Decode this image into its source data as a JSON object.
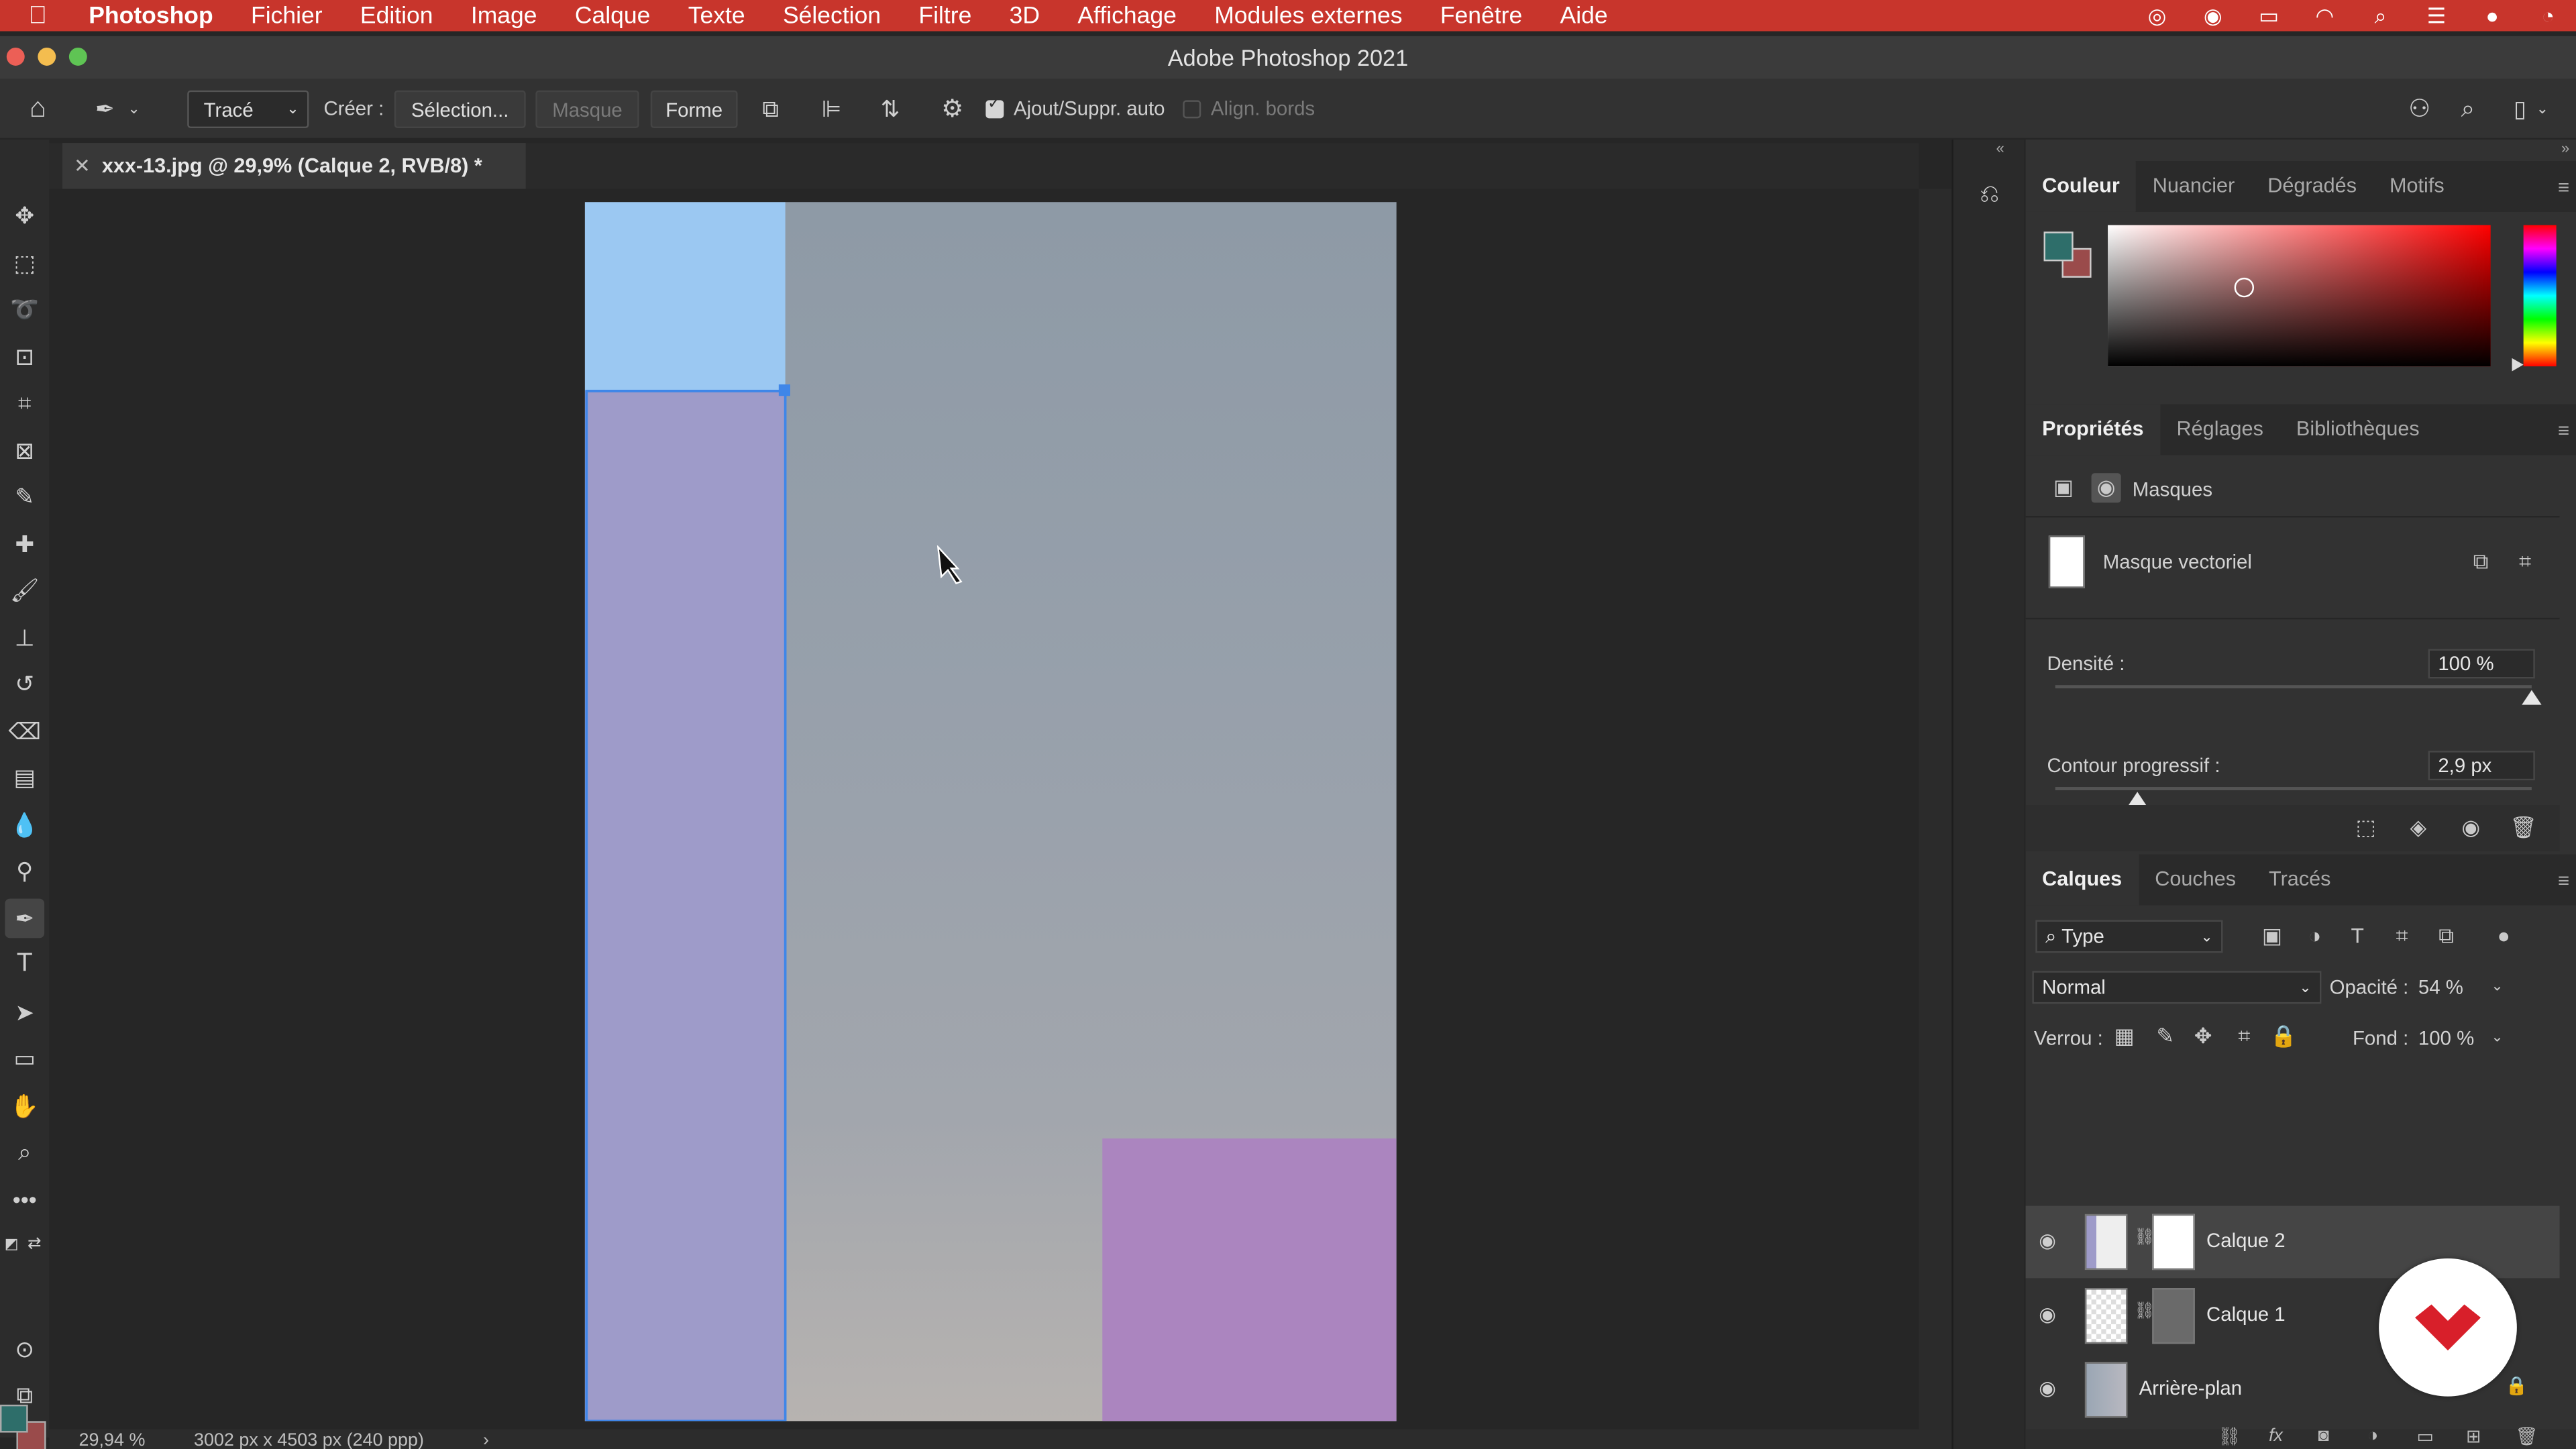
{
  "menubar": {
    "app": "Photoshop",
    "items": [
      "Fichier",
      "Edition",
      "Image",
      "Calque",
      "Texte",
      "Sélection",
      "Filtre",
      "3D",
      "Affichage",
      "Modules externes",
      "Fenêtre",
      "Aide"
    ]
  },
  "window": {
    "title": "Adobe Photoshop 2021"
  },
  "options": {
    "mode": "Tracé",
    "create_label": "Créer :",
    "selection": "Sélection...",
    "mask": "Masque",
    "shape": "Forme",
    "auto_add": "Ajout/Suppr. auto",
    "align_edges": "Align. bords"
  },
  "document": {
    "tab_title": "xxx-13.jpg @ 29,9% (Calque 2, RVB/8) *"
  },
  "status": {
    "zoom": "29,94 %",
    "size": "3002 px x 4503 px (240 ppp)",
    "arrow": "›"
  },
  "colors": {
    "foreground": "#2e6e6a",
    "background": "#9a4b4b",
    "menubar": "#c8352c"
  },
  "color_panel": {
    "tabs": [
      "Couleur",
      "Nuancier",
      "Dégradés",
      "Motifs"
    ]
  },
  "properties": {
    "tabs": [
      "Propriétés",
      "Réglages",
      "Bibliothèques"
    ],
    "section": "Masques",
    "mask_type": "Masque vectoriel",
    "density_label": "Densité :",
    "density": "100 %",
    "density_level": 1.0,
    "feather_label": "Contour progressif :",
    "feather": "2,9 px",
    "feather_level": 0.02
  },
  "layers": {
    "tabs": [
      "Calques",
      "Couches",
      "Tracés"
    ],
    "filter": "Type",
    "blend": "Normal",
    "opacity_label": "Opacité :",
    "opacity": "54 %",
    "lock_label": "Verrou :",
    "fill_label": "Fond :",
    "fill": "100 %",
    "items": [
      {
        "name": "Calque 2",
        "selected": true
      },
      {
        "name": "Calque 1",
        "selected": false
      },
      {
        "name": "Arrière-plan",
        "selected": false
      }
    ]
  }
}
